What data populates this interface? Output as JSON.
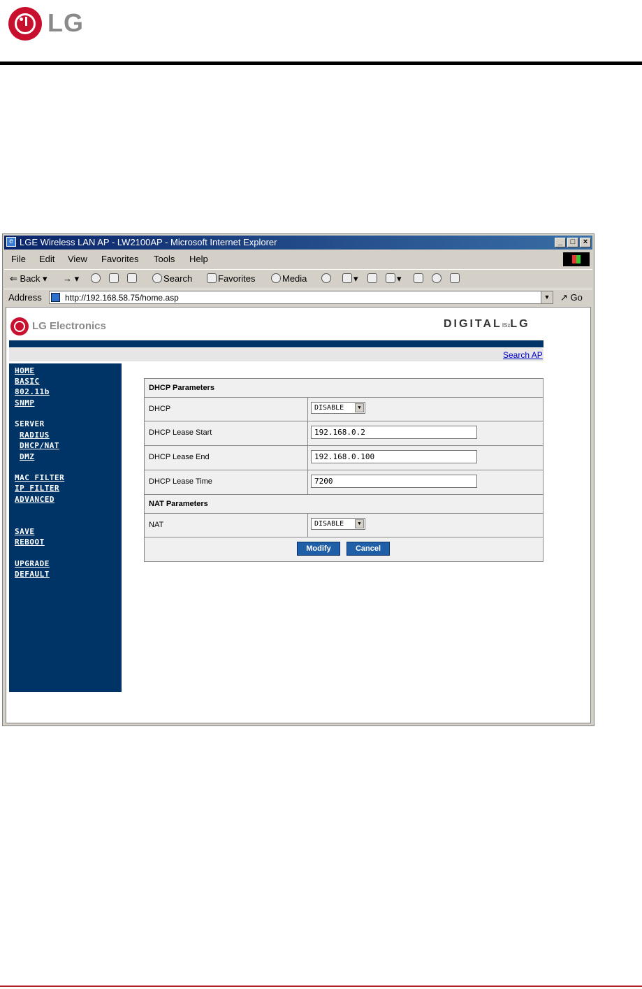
{
  "doc": {
    "brand_logo_text": "LG",
    "colors": {
      "rule": "#000000",
      "footer_rule": "#b3202a",
      "brand_red": "#c8102e"
    }
  },
  "browser": {
    "title": "LGE Wireless LAN AP - LW2100AP - Microsoft Internet Explorer",
    "window_buttons": [
      "_",
      "□",
      "×"
    ],
    "menu": [
      "File",
      "Edit",
      "View",
      "Favorites",
      "Tools",
      "Help"
    ],
    "toolbar": {
      "back": "Back",
      "search": "Search",
      "favorites": "Favorites",
      "media": "Media"
    },
    "address_label": "Address",
    "url": "http://192.168.58.75/home.asp",
    "go": "Go"
  },
  "page": {
    "brand_text": "LG Electronics",
    "digital_logo": {
      "left": "DIGITAL",
      "mid": "ISz",
      "right": "LG"
    },
    "search_link": "Search AP",
    "colors": {
      "nav_bg": "#003366",
      "band_grey": "#e6e6e6",
      "button_blue": "#1f5fa8"
    },
    "nav": {
      "home": "HOME",
      "basic": "BASIC",
      "dot11b": "802.11b",
      "snmp": "SNMP",
      "server": "SERVER",
      "radius": "RADIUS",
      "dhcp_nat": "DHCP/NAT",
      "dmz": "DMZ",
      "mac_filter": "MAC FILTER",
      "ip_filter": "IP FILTER",
      "advanced": "ADVANCED",
      "save": "SAVE",
      "reboot": "REBOOT",
      "upgrade": "UPGRADE",
      "default": "DEFAULT"
    },
    "dhcp_section": "DHCP Parameters",
    "dhcp": {
      "label": "DHCP",
      "value": "DISABLE"
    },
    "lease_start": {
      "label": "DHCP Lease Start",
      "value": "192.168.0.2"
    },
    "lease_end": {
      "label": "DHCP Lease End",
      "value": "192.168.0.100"
    },
    "lease_time": {
      "label": "DHCP Lease Time",
      "value": "7200"
    },
    "nat_section": "NAT Parameters",
    "nat": {
      "label": "NAT",
      "value": "DISABLE"
    },
    "modify": "Modify",
    "cancel": "Cancel"
  }
}
